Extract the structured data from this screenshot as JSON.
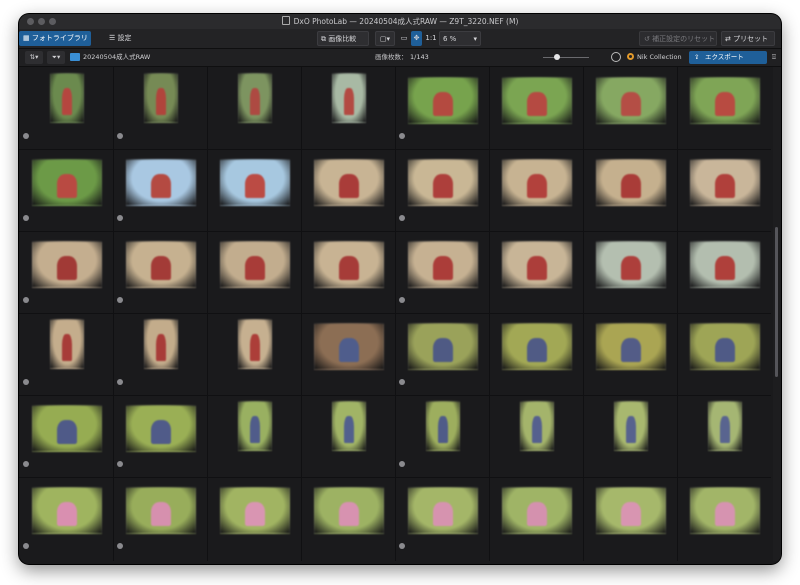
{
  "window": {
    "title": "DxO PhotoLab — 20240504成人式RAW — Z9T_3220.NEF (M)"
  },
  "toolbar": {
    "library_tab": "フォトライブラリ",
    "settings_tab": "設定",
    "compare": "画像比較",
    "ratio": "1:1",
    "zoom": "6 %",
    "reset": "補正設定のリセット",
    "preset": "プリセット"
  },
  "subbar": {
    "folder": "20240504成人式RAW",
    "count_label": "画像枚数：",
    "count_value": "1/143",
    "nik": "Nik Collection",
    "export": "エクスポート"
  },
  "icons": [
    "window-close-icon",
    "window-minimize-icon",
    "window-zoom-icon",
    "document-icon",
    "grid-icon",
    "sliders-icon",
    "compare-icon",
    "layout-icon",
    "fit-icon",
    "move-icon",
    "chevron-down-icon",
    "reset-icon",
    "preset-icon",
    "sort-icon",
    "filter-icon",
    "folder-icon",
    "slider-knob-icon",
    "eye-icon",
    "nik-icon",
    "export-icon",
    "share-icon"
  ],
  "colors": {
    "accent": "#1f5f99",
    "background": "#1a1a1c",
    "nik": "#e39a2b"
  },
  "thumbnails": [
    {
      "orient": "port",
      "bg": "#6b8a4e",
      "fg": "#b5463f"
    },
    {
      "orient": "port",
      "bg": "#768a55",
      "fg": "#b0443c"
    },
    {
      "orient": "port",
      "bg": "#7d9460",
      "fg": "#ad4a42"
    },
    {
      "orient": "port",
      "bg": "#a8b9a4",
      "fg": "#b34a42"
    },
    {
      "orient": "land",
      "bg": "#77a34d",
      "fg": "#b44a40"
    },
    {
      "orient": "land",
      "bg": "#7ba552",
      "fg": "#b54a42"
    },
    {
      "orient": "land",
      "bg": "#86a862",
      "fg": "#b44e45"
    },
    {
      "orient": "land",
      "bg": "#7fa556",
      "fg": "#b84b41"
    },
    {
      "orient": "land",
      "bg": "#6c9a47",
      "fg": "#b94a42"
    },
    {
      "orient": "land",
      "bg": "#a9c8e2",
      "fg": "#b44a42"
    },
    {
      "orient": "land",
      "bg": "#a7c8e0",
      "fg": "#bb4b44"
    },
    {
      "orient": "land",
      "bg": "#c8b494",
      "fg": "#a93c39"
    },
    {
      "orient": "land",
      "bg": "#c9b795",
      "fg": "#ad3f3b"
    },
    {
      "orient": "land",
      "bg": "#c7b392",
      "fg": "#b2413c"
    },
    {
      "orient": "land",
      "bg": "#c5b08e",
      "fg": "#a93c38"
    },
    {
      "orient": "land",
      "bg": "#c9b69a",
      "fg": "#b0403b"
    },
    {
      "orient": "land",
      "bg": "#c4ae8f",
      "fg": "#a13a36"
    },
    {
      "orient": "land",
      "bg": "#c6b190",
      "fg": "#a33b37"
    },
    {
      "orient": "land",
      "bg": "#c2ad8e",
      "fg": "#a83c38"
    },
    {
      "orient": "land",
      "bg": "#c8b393",
      "fg": "#a63c38"
    },
    {
      "orient": "land",
      "bg": "#c6b192",
      "fg": "#ab3d39"
    },
    {
      "orient": "land",
      "bg": "#c8b597",
      "fg": "#ac3e3a"
    },
    {
      "orient": "land",
      "bg": "#b4bfb0",
      "fg": "#ad3f3b"
    },
    {
      "orient": "land",
      "bg": "#b3beaf",
      "fg": "#af403b"
    },
    {
      "orient": "port",
      "bg": "#c4ad8c",
      "fg": "#a73c38"
    },
    {
      "orient": "port",
      "bg": "#c3ac8b",
      "fg": "#a83c38"
    },
    {
      "orient": "port",
      "bg": "#c6b090",
      "fg": "#ac3e39"
    },
    {
      "orient": "land",
      "bg": "#8c6e54",
      "fg": "#4f5d8c"
    },
    {
      "orient": "land",
      "bg": "#9aa25a",
      "fg": "#4f5a84"
    },
    {
      "orient": "land",
      "bg": "#a2a855",
      "fg": "#505b85"
    },
    {
      "orient": "land",
      "bg": "#aaa553",
      "fg": "#535c87"
    },
    {
      "orient": "land",
      "bg": "#9ea556",
      "fg": "#4f5a86"
    },
    {
      "orient": "land",
      "bg": "#96ac52",
      "fg": "#4f5a88"
    },
    {
      "orient": "land",
      "bg": "#9aaf55",
      "fg": "#505b89"
    },
    {
      "orient": "port",
      "bg": "#99b061",
      "fg": "#505c8a"
    },
    {
      "orient": "port",
      "bg": "#a1b466",
      "fg": "#52608d"
    },
    {
      "orient": "port",
      "bg": "#9dae5e",
      "fg": "#4f5b88"
    },
    {
      "orient": "port",
      "bg": "#a4b46b",
      "fg": "#55608e"
    },
    {
      "orient": "port",
      "bg": "#a8b86f",
      "fg": "#57628e"
    },
    {
      "orient": "port",
      "bg": "#a5b673",
      "fg": "#59648f"
    },
    {
      "orient": "land",
      "bg": "#9fb45f",
      "fg": "#d98fb0"
    },
    {
      "orient": "land",
      "bg": "#98ad5b",
      "fg": "#d690ae"
    },
    {
      "orient": "land",
      "bg": "#a1b462",
      "fg": "#d995b2"
    },
    {
      "orient": "land",
      "bg": "#9db263",
      "fg": "#d792b0"
    },
    {
      "orient": "land",
      "bg": "#a4b668",
      "fg": "#d693af"
    },
    {
      "orient": "land",
      "bg": "#9fb466",
      "fg": "#d491ae"
    },
    {
      "orient": "land",
      "bg": "#a6b86b",
      "fg": "#d895b1"
    },
    {
      "orient": "land",
      "bg": "#a2b568",
      "fg": "#d693b0"
    }
  ]
}
